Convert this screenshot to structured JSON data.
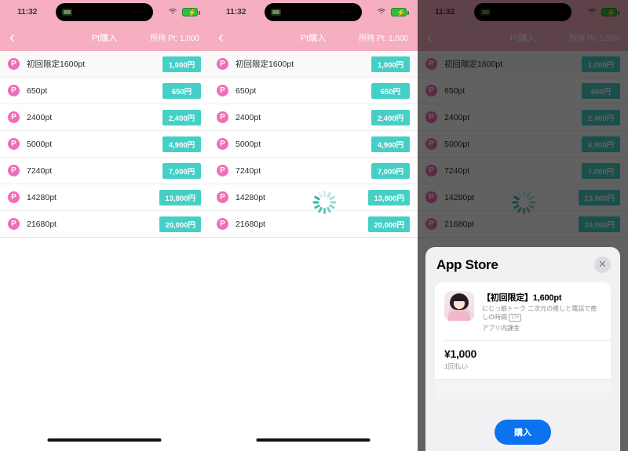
{
  "status_bar": {
    "time": "11:32",
    "wifi_icon": "wifi-icon",
    "battery_icon": "battery-charging-icon",
    "dots": "······"
  },
  "nav": {
    "back_icon": "‹",
    "title": "Pt購入",
    "points_label": "所持 Pt: 1,000"
  },
  "point_items": [
    {
      "label": "初回限定1600pt",
      "price": "1,000円"
    },
    {
      "label": "650pt",
      "price": "650円"
    },
    {
      "label": "2400pt",
      "price": "2,400円"
    },
    {
      "label": "5000pt",
      "price": "4,900円"
    },
    {
      "label": "7240pt",
      "price": "7,000円"
    },
    {
      "label": "14280pt",
      "price": "13,800円"
    },
    {
      "label": "21680pt",
      "price": "20,000円"
    }
  ],
  "p_icon_letter": "P",
  "app_store_sheet": {
    "title": "App Store",
    "close_icon": "✕",
    "item_title": "【初回限定】1,600pt",
    "item_subtitle": "にじっ娘トーク 二次元の推しと電話で癒しの時間",
    "age_rating": "17+",
    "iap_label": "アプリ内課金",
    "price": "¥1,000",
    "price_note": "1回払い",
    "buy_button": "購入"
  },
  "colors": {
    "header_pink": "#f5afc0",
    "badge_teal": "#46cfc6",
    "point_icon_pink": "#f06eb8",
    "buy_blue": "#0b72f0",
    "spinner_teal": "#2bb3ac"
  }
}
